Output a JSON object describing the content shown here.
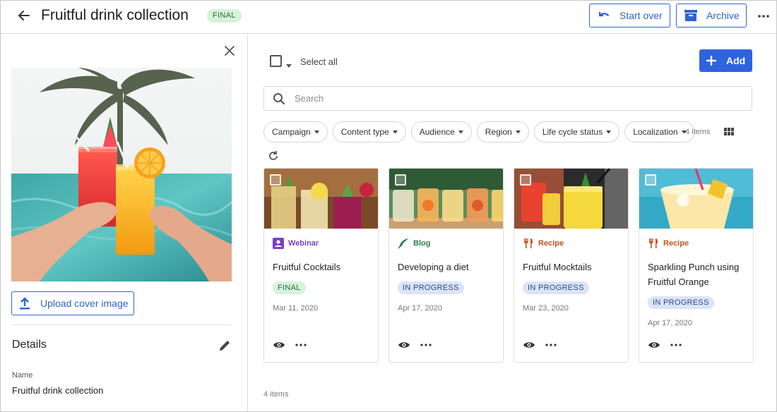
{
  "header": {
    "title": "Fruitful drink collection",
    "badge": "FINAL",
    "start_over_label": "Start over",
    "archive_label": "Archive"
  },
  "left_panel": {
    "upload_label": "Upload cover image",
    "details_heading": "Details",
    "name_label": "Name",
    "name_value": "Fruitful drink collection"
  },
  "toolbar": {
    "select_all_label": "Select all",
    "add_label": "Add",
    "search_placeholder": "Search"
  },
  "filters": [
    "Campaign",
    "Content type",
    "Audience",
    "Region",
    "Life cycle status",
    "Localization"
  ],
  "item_count_top": "4 items",
  "item_count_bottom": "4 items",
  "cards": [
    {
      "type": "Webinar",
      "type_color": "#7b3fc4",
      "icon": "webinar-icon",
      "title": "Fruitful Cocktails",
      "status": "FINAL",
      "status_kind": "final",
      "date": "Mar 11, 2020"
    },
    {
      "type": "Blog",
      "type_color": "#2e7d4f",
      "icon": "feather-icon",
      "title": "Developing a diet",
      "status": "IN PROGRESS",
      "status_kind": "progress",
      "date": "Apr 17, 2020"
    },
    {
      "type": "Recipe",
      "type_color": "#c4521e",
      "icon": "fork-knife-icon",
      "title": "Fruitful Mocktails",
      "status": "IN PROGRESS",
      "status_kind": "progress",
      "date": "Mar 23, 2020"
    },
    {
      "type": "Recipe",
      "type_color": "#c4521e",
      "icon": "fork-knife-icon",
      "title": "Sparkling Punch using Fruitful Orange",
      "status": "IN PROGRESS",
      "status_kind": "progress",
      "date": "Apr 17, 2020"
    }
  ],
  "colors": {
    "accent": "#2f63cf",
    "final_bg": "#d7f2dc",
    "progress_bg": "#dbe4f7"
  }
}
